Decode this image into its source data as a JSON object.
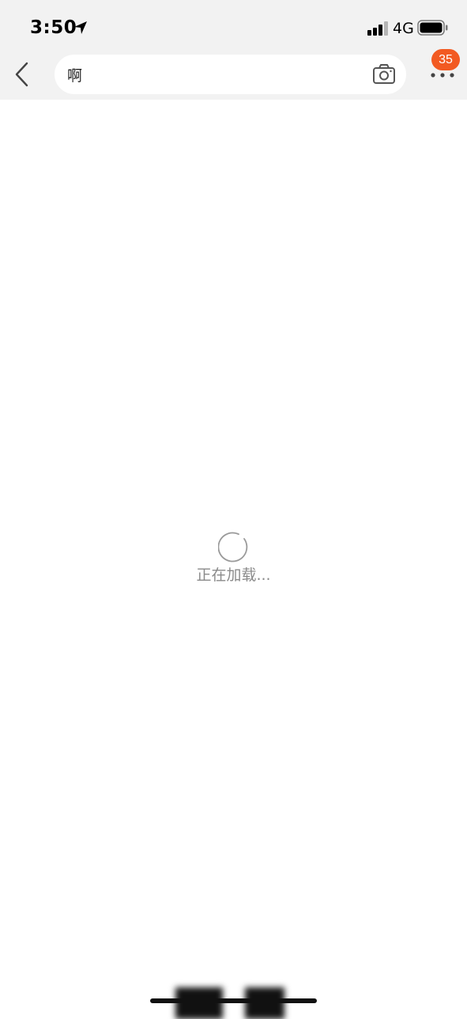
{
  "status_bar": {
    "time": "3:50",
    "network": "4G",
    "location_icon": "location-arrow-icon",
    "signal_icon": "cellular-signal-icon",
    "battery_icon": "battery-full-icon"
  },
  "nav": {
    "back_icon": "chevron-left-icon",
    "search": {
      "value": "啊"
    },
    "camera_icon": "camera-icon",
    "more_icon": "more-dots-icon",
    "badge_count": "35"
  },
  "loading": {
    "text": "正在加载..."
  },
  "colors": {
    "header_bg": "#f2f2f2",
    "badge": "#f25a22",
    "loading_text": "#8a8a8a"
  }
}
